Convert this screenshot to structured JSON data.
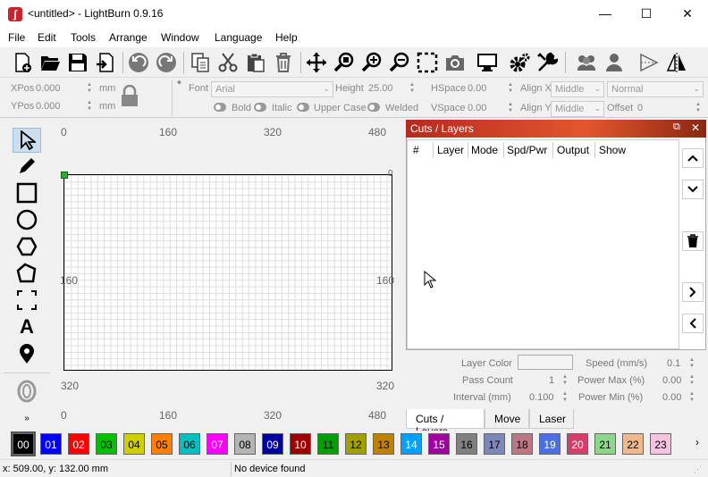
{
  "titlebar": {
    "app_icon": "lightburn-icon",
    "title": "<untitled> - LightBurn 0.9.16",
    "minimize": "—",
    "maximize": "☐",
    "close": "✕"
  },
  "menu": [
    "File",
    "Edit",
    "Tools",
    "Arrange",
    "Window",
    "Language",
    "Help"
  ],
  "toolbar": {
    "icons": [
      "new-file-icon",
      "open-folder-icon",
      "save-icon",
      "import-icon",
      "undo-icon",
      "redo-icon",
      "copy-icon",
      "cut-icon",
      "paste-icon",
      "delete-icon",
      "move-icon",
      "zoom-selection-icon",
      "zoom-in-icon",
      "zoom-out-icon",
      "frame-selection-icon",
      "camera-icon",
      "monitor-icon",
      "settings-gear-icon",
      "tools-wrench-icon",
      "group-users-icon",
      "user-icon",
      "mirror-horizontal-icon",
      "mirror-vertical-icon"
    ]
  },
  "props": {
    "xpos_label": "XPos",
    "xpos_value": "0.000",
    "ypos_label": "YPos",
    "ypos_value": "0.000",
    "unit": "mm",
    "font_label": "Font",
    "font_value": "Arial",
    "height_label": "Height",
    "height_value": "25.00",
    "hspace_label": "HSpace",
    "hspace_value": "0.00",
    "vspace_label": "VSpace",
    "vspace_value": "0.00",
    "alignx_label": "Align X",
    "alignx_value": "Middle",
    "aligny_label": "Align Y",
    "aligny_value": "Middle",
    "normal_value": "Normal",
    "offset_label": "Offset",
    "offset_value": "0",
    "bold": "Bold",
    "italic": "Italic",
    "uppercase": "Upper Case",
    "welded": "Welded"
  },
  "rulers": {
    "top": [
      "0",
      "160",
      "320",
      "480"
    ],
    "bottom": [
      "0",
      "160",
      "320",
      "480"
    ],
    "left": [
      "160",
      "320"
    ],
    "right": [
      "0",
      "160",
      "320"
    ]
  },
  "cuts": {
    "title": "Cuts / Layers",
    "columns": [
      "#",
      "Layer",
      "Mode",
      "Spd/Pwr",
      "Output",
      "Show"
    ]
  },
  "layer_props": {
    "layer_color": "Layer Color",
    "speed_label": "Speed (mm/s)",
    "speed_value": "0.1",
    "pass_label": "Pass Count",
    "pass_value": "1",
    "pmax_label": "Power Max (%)",
    "pmax_value": "0.00",
    "interval_label": "Interval (mm)",
    "interval_value": "0.100",
    "pmin_label": "Power Min (%)",
    "pmin_value": "0.00"
  },
  "tabs": [
    "Cuts / Layers",
    "Move",
    "Laser"
  ],
  "palette": [
    {
      "n": "00",
      "c": "#000000",
      "t": "#fff"
    },
    {
      "n": "01",
      "c": "#0000ff",
      "t": "#fff"
    },
    {
      "n": "02",
      "c": "#ff0000",
      "t": "#fff"
    },
    {
      "n": "03",
      "c": "#00c000",
      "t": "#000"
    },
    {
      "n": "04",
      "c": "#d0d000",
      "t": "#000"
    },
    {
      "n": "05",
      "c": "#ff8000",
      "t": "#000"
    },
    {
      "n": "06",
      "c": "#00c0c0",
      "t": "#000"
    },
    {
      "n": "07",
      "c": "#ff00ff",
      "t": "#fff"
    },
    {
      "n": "08",
      "c": "#b4b4b4",
      "t": "#000"
    },
    {
      "n": "09",
      "c": "#0000a0",
      "t": "#fff"
    },
    {
      "n": "10",
      "c": "#a00000",
      "t": "#fff"
    },
    {
      "n": "11",
      "c": "#00a000",
      "t": "#000"
    },
    {
      "n": "12",
      "c": "#a0a000",
      "t": "#000"
    },
    {
      "n": "13",
      "c": "#c08000",
      "t": "#000"
    },
    {
      "n": "14",
      "c": "#00a0ff",
      "t": "#fff"
    },
    {
      "n": "15",
      "c": "#a000a0",
      "t": "#fff"
    },
    {
      "n": "16",
      "c": "#808080",
      "t": "#000"
    },
    {
      "n": "17",
      "c": "#7d87b9",
      "t": "#000"
    },
    {
      "n": "18",
      "c": "#bb7784",
      "t": "#000"
    },
    {
      "n": "19",
      "c": "#4a6fe3",
      "t": "#fff"
    },
    {
      "n": "20",
      "c": "#d33f6a",
      "t": "#fff"
    },
    {
      "n": "21",
      "c": "#8cd78c",
      "t": "#000"
    },
    {
      "n": "22",
      "c": "#f0b98d",
      "t": "#000"
    },
    {
      "n": "23",
      "c": "#f6c4e1",
      "t": "#000"
    }
  ],
  "status": {
    "position": "x: 509.00, y: 132.00 mm",
    "device": "No device found"
  }
}
